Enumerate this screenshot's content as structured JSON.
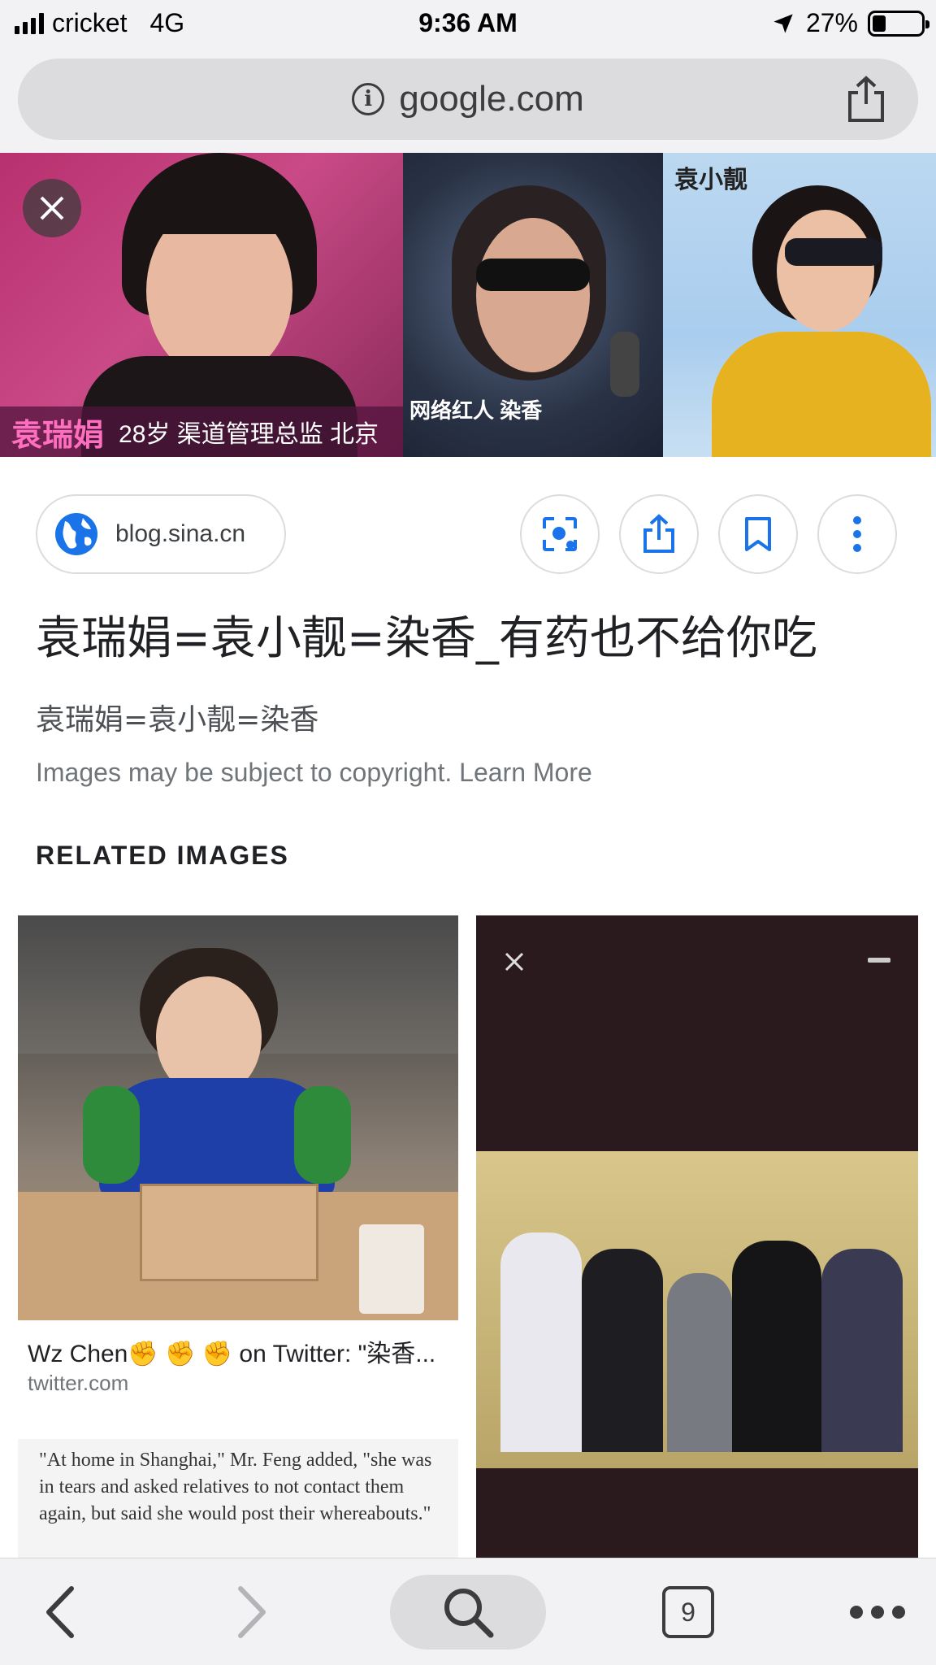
{
  "status_bar": {
    "carrier": "cricket",
    "network": "4G",
    "time": "9:36 AM",
    "battery": "27%",
    "battery_level": 0.27
  },
  "browser": {
    "url": "google.com",
    "info_icon": "info-icon",
    "share_icon": "share-icon"
  },
  "hero": {
    "panel1_name": "袁瑞娟",
    "panel1_caption": "28岁 渠道管理总监 北京",
    "panel2_caption": "网络红人 染香",
    "panel3_caption": "袁小靓"
  },
  "result": {
    "source": "blog.sina.cn",
    "title": "袁瑞娟=袁小靓=染香_有药也不给你吃",
    "subtitle": "袁瑞娟=袁小靓=染香",
    "copyright": "Images may be subject to copyright.",
    "learn_more": "Learn More",
    "actions": [
      "lens-icon",
      "share-icon",
      "bookmark-icon",
      "more-vert-icon"
    ]
  },
  "related": {
    "heading": "RELATED IMAGES",
    "items": [
      {
        "title": "Wz Chen✊ ✊ ✊ on Twitter: \"染香...",
        "source": "twitter.com"
      },
      {
        "quote": "\"At home in Shanghai,\" Mr. Feng added, \"she was in tears and asked relatives to not contact them again, but said she would post their whereabouts.\""
      }
    ]
  },
  "toolbar": {
    "tab_count": "9",
    "icons": [
      "back-icon",
      "forward-icon",
      "search-icon",
      "tabs-icon",
      "more-icon"
    ]
  },
  "colors": {
    "accent_blue": "#1a73e8",
    "chrome_gray": "#f2f2f4"
  }
}
